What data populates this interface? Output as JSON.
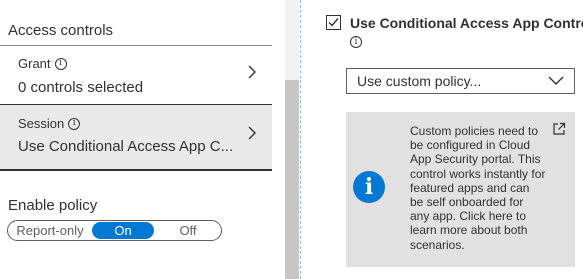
{
  "left_panel": {
    "section_title": "Access controls",
    "grant": {
      "label": "Grant",
      "value": "0 controls selected"
    },
    "session": {
      "label": "Session",
      "value": "Use Conditional Access App C..."
    },
    "enable_policy": {
      "label": "Enable policy",
      "options": [
        "Report-only",
        "On",
        "Off"
      ],
      "selected": "On"
    }
  },
  "right_panel": {
    "checkbox": {
      "label": "Use Conditional Access App Control",
      "checked": true
    },
    "dropdown": {
      "value": "Use custom policy..."
    },
    "info_box": {
      "text": "Custom policies need to be configured in Cloud App Security portal. This control works instantly for featured apps and can be self onboarded for any app. Click here to learn more about both scenarios."
    }
  },
  "colors": {
    "accent": "#0078d4",
    "selected_row_bg": "#e9e9e9",
    "info_box_bg": "#e1e1e1"
  },
  "icons": [
    "info-circle-icon",
    "chevron-right-icon",
    "checkmark-icon",
    "chevron-down-icon",
    "info-icon",
    "external-link-icon"
  ]
}
